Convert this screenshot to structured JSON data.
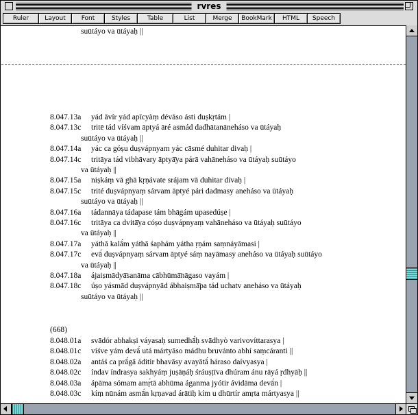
{
  "window": {
    "title": "rvres"
  },
  "toolbar": {
    "buttons": [
      "Ruler",
      "Layout",
      "Font",
      "Styles",
      "Table",
      "List",
      "Merge",
      "BookMark",
      "HTML",
      "Speech"
    ]
  },
  "document": {
    "top_cont": "suūtáyo va ūtáyaḥ ||",
    "verses": [
      {
        "ref": "8.047.13a",
        "text": "yád āvír yád apīcyàṃ dévāso ásti duṣkṛtám |"
      },
      {
        "ref": "8.047.13c",
        "text": "tritē tád víśvam āptyá āré asmád dadhātanāneháso va ūtáyaḥ"
      },
      {
        "cont": "suūtáyo va ūtáyaḥ ||"
      },
      {
        "ref": "8.047.14a",
        "text": "yác ca góṣu duṣvápnyam yác cāsmé duhitar divaḥ |"
      },
      {
        "ref": "8.047.14c",
        "text": "tritāya tád vibhāvary āptyā̄ya párā vahāneháso va ūtáyaḥ suūtáyo"
      },
      {
        "cont": "va ūtáyaḥ ||"
      },
      {
        "ref": "8.047.15a",
        "text": "niṣkáṃ vā ghā kṛṇávate srájam vā duhitar divaḥ |"
      },
      {
        "ref": "8.047.15c",
        "text": "trité duṣvápnyaṃ sárvam āptyé pári dadmasy aneháso va ūtáyaḥ"
      },
      {
        "cont": "suūtáyo va ūtáyaḥ ||"
      },
      {
        "ref": "8.047.16a",
        "text": "tádannāya tádapase tám bhāgám upasedúṣe |"
      },
      {
        "ref": "8.047.16c",
        "text": "tritāya ca dvitā̄ya cóṣo duṣvápnyaṃ vahāneháso va ūtáyaḥ suūtáyo"
      },
      {
        "cont": "va ūtáyaḥ ||"
      },
      {
        "ref": "8.047.17a",
        "text": "yáthā kalā́m yáthā śaphám yátha ṛṇám saṃnáyāmasi |"
      },
      {
        "ref": "8.047.17c",
        "text": "evā́ duṣvápnyaṃ sárvam āptyé sáṃ nayāmasy aneháso va ūtáyaḥ suūtáyo"
      },
      {
        "cont": "va ūtáyaḥ ||"
      },
      {
        "ref": "8.047.18a",
        "text": "ájaiṣmādyā̄sanāma cābhūmā̄nāgaso vayám |"
      },
      {
        "ref": "8.047.18c",
        "text": "úṣo yásmād duṣvápnyād ábhaiṣmā̄pa tád uchatv aneháso va ūtáyaḥ"
      },
      {
        "cont": "suūtáyo va ūtáyaḥ ||"
      }
    ],
    "section_label": "(668)",
    "verses2": [
      {
        "ref": "8.048.01a",
        "text": "svādór abhakṣi váyasaḥ sumedhā́ḥ svādhyò varivovíttarasya |"
      },
      {
        "ref": "8.048.01c",
        "text": "víśve yám devā́ utá mártyāso mádhu bruvánto abhí saṃcáranti ||"
      },
      {
        "ref": "8.048.02a",
        "text": "antáś ca prā́gā áditir bhavāsy avayātā́ háraso daívyasya |"
      },
      {
        "ref": "8.048.02c",
        "text": "índav índrasya sakhyáṃ juṣāṇáḥ śráuṣṭīva dhúram ánu rāyá ṛdhyāḥ ||"
      },
      {
        "ref": "8.048.03a",
        "text": "ápāma sómam amṛ́tā abhūma áganma jyótir ávidāma devā́n |"
      },
      {
        "ref": "8.048.03c",
        "text": "kíṃ nūnám asmā́n kṛṇavad árātiḥ kím u dhūrtír amṛta mártyasya ||"
      }
    ]
  },
  "scrollbars": {
    "vertical_position": 0.66,
    "horizontal_position": 0.0
  }
}
